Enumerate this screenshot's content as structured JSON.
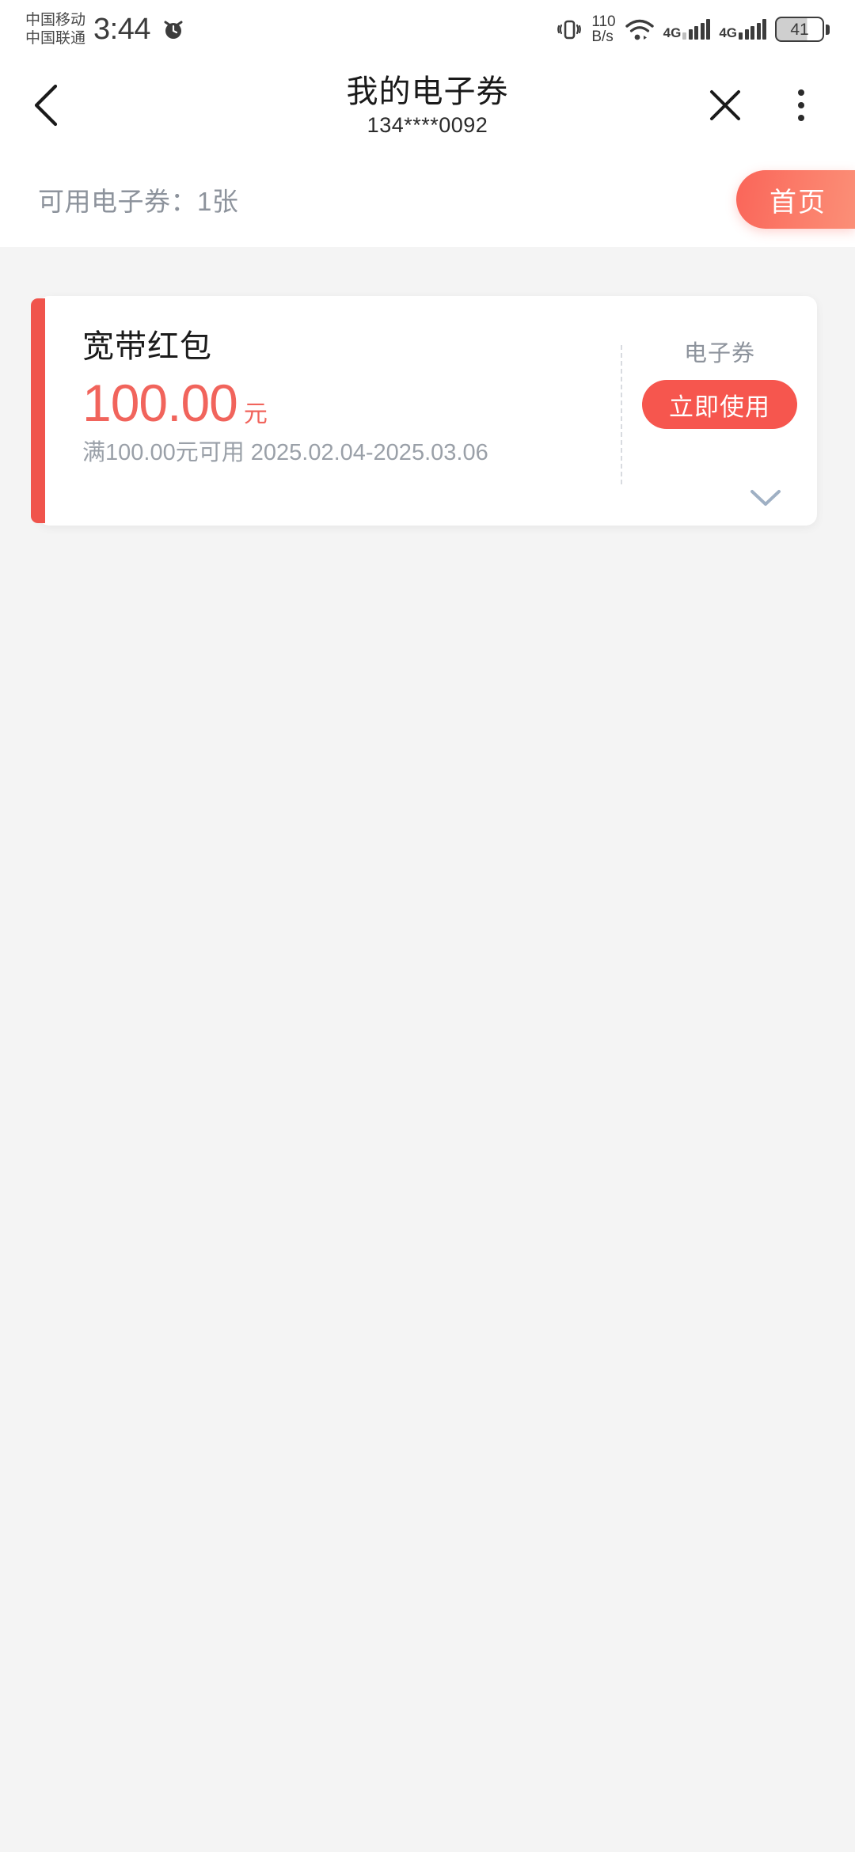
{
  "status_bar": {
    "carrier_primary": "中国移动",
    "carrier_secondary": "中国联通",
    "time": "3:44",
    "alarm_icon": "alarm-clock-icon",
    "vibrate_icon": "vibrate-icon",
    "net_speed_value": "110",
    "net_speed_unit": "B/s",
    "wifi_icon": "wifi-icon",
    "signal_1_label": "4G",
    "signal_2_label": "4G",
    "battery_level": "41"
  },
  "nav": {
    "back_icon": "chevron-left-icon",
    "title": "我的电子券",
    "subtitle": "134****0092",
    "close_icon": "close-icon",
    "more_icon": "more-vertical-icon"
  },
  "subbar": {
    "available_text": "可用电子券：1张",
    "home_label": "首页"
  },
  "coupons": [
    {
      "title": "宽带红包",
      "amount": "100.00",
      "unit": "元",
      "condition": "满100.00元可用 2025.02.04-2025.03.06",
      "type_label": "电子券",
      "action_label": "立即使用",
      "expand_icon": "chevron-down-icon"
    }
  ],
  "colors": {
    "accent_red": "#f6564e",
    "stripe_red": "#f0544c",
    "amount_red": "#f1645c",
    "muted_gray": "#8d939c",
    "page_bg": "#f4f4f4"
  }
}
